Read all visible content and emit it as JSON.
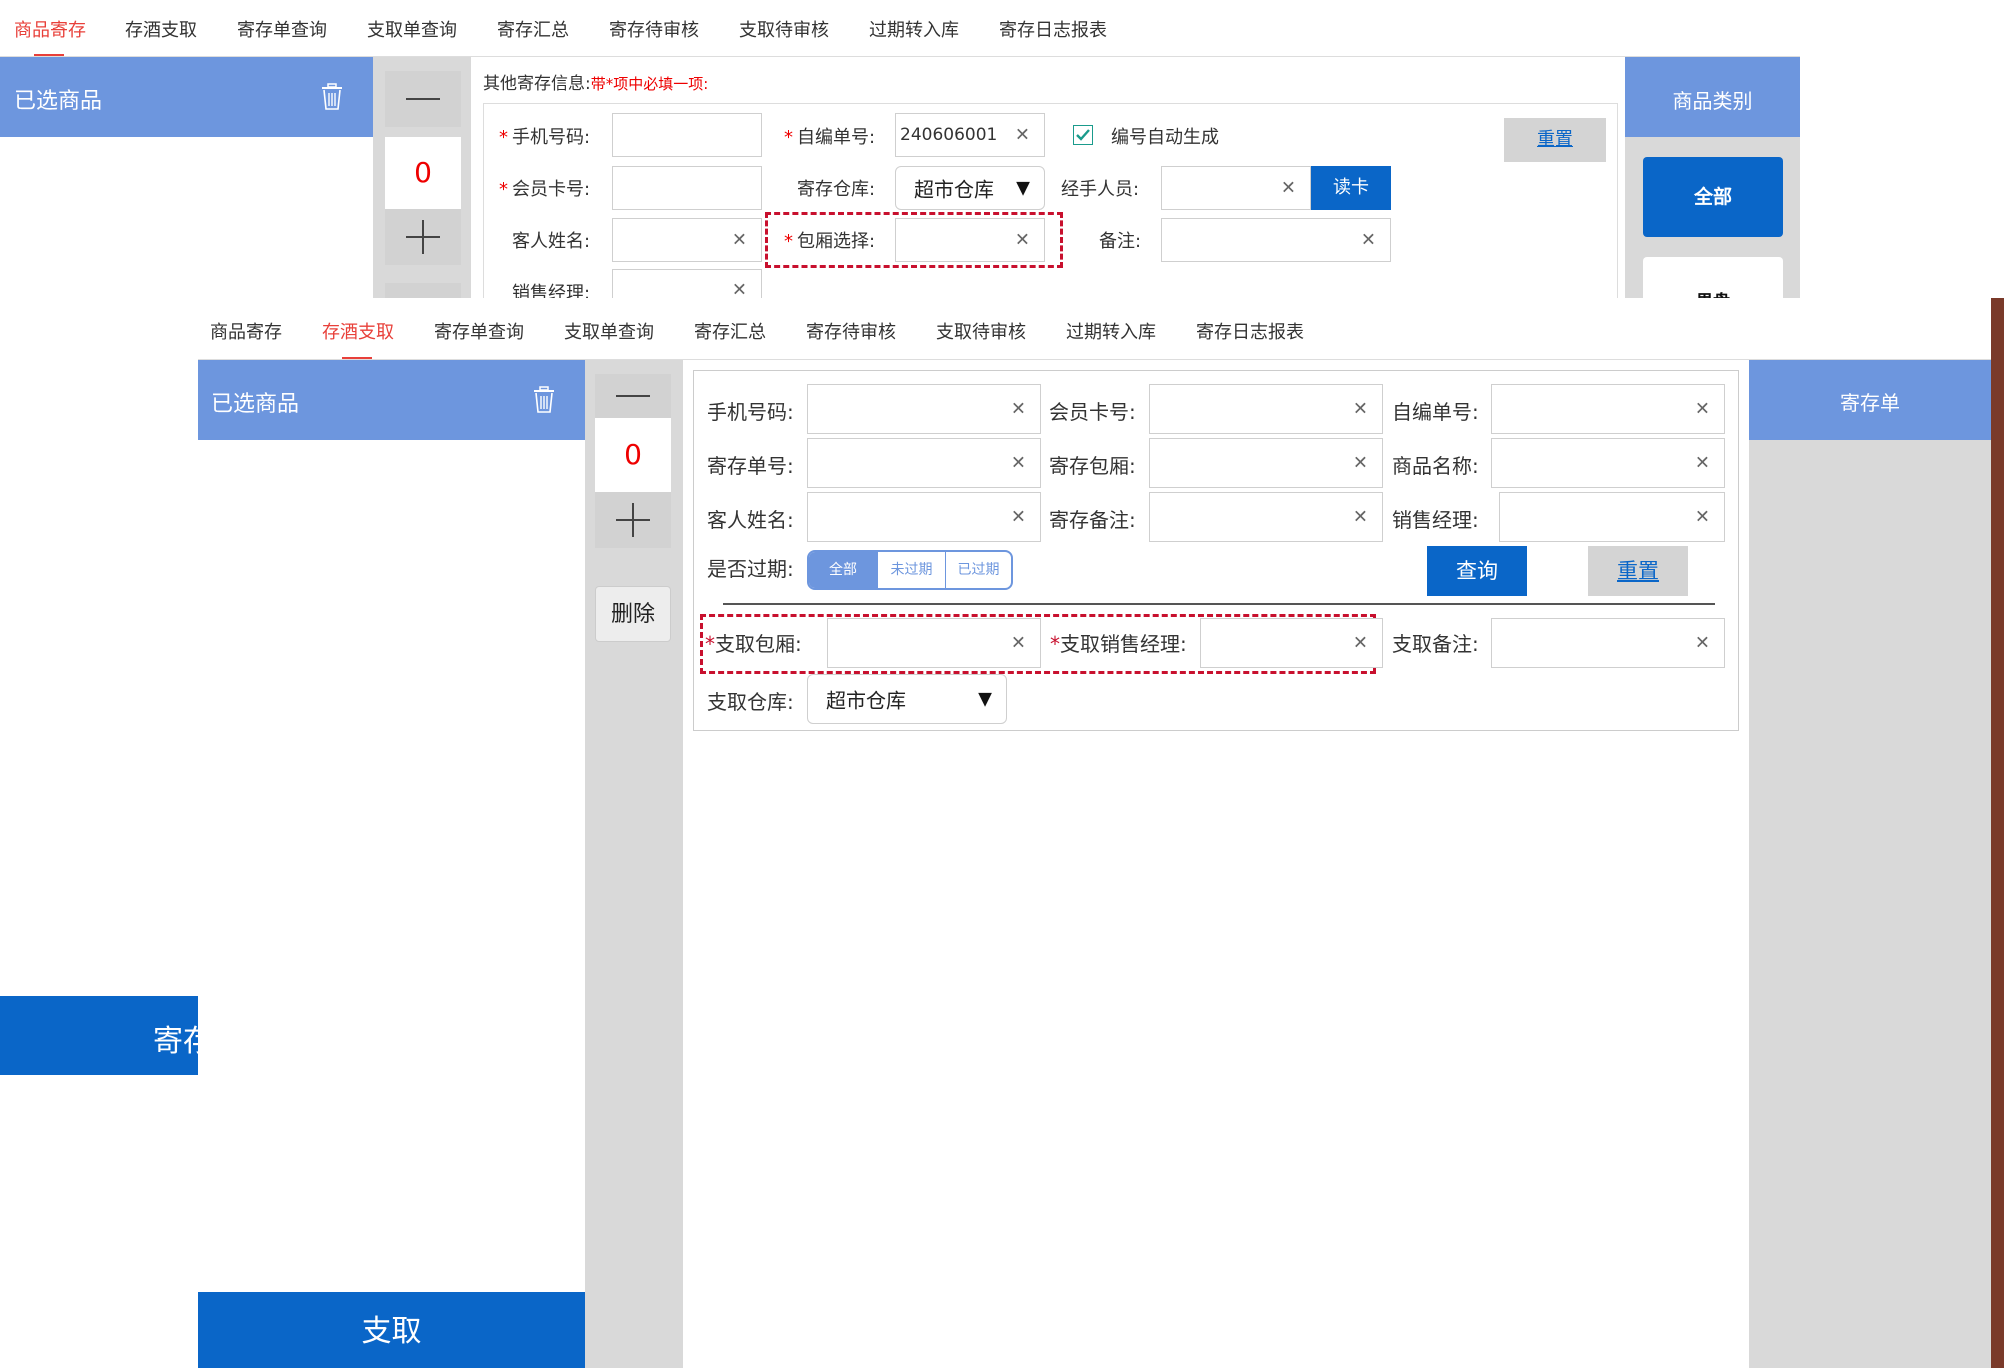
{
  "top": {
    "tabs": [
      "商品寄存",
      "存酒支取",
      "寄存单查询",
      "支取单查询",
      "寄存汇总",
      "寄存待审核",
      "支取待审核",
      "过期转入库",
      "寄存日志报表"
    ],
    "selected_header": "已选商品",
    "qty": "0",
    "form_title": "其他寄存信息:",
    "form_required_note": "带*项中必填一项:",
    "labels": {
      "phone": "手机号码:",
      "custom_no": "自编单号:",
      "member": "会员卡号:",
      "warehouse": "寄存仓库:",
      "handler": "经手人员:",
      "guest": "客人姓名:",
      "room": "包厢选择:",
      "note": "备注:",
      "manager": "销售经理:"
    },
    "custom_no_value": "240606001",
    "auto_gen_label": "编号自动生成",
    "warehouse_value": "超市仓库",
    "read_card": "读卡",
    "reset": "重置",
    "category_header": "商品类别",
    "category_all": "全部",
    "category_partial": "果盘"
  },
  "bottom": {
    "tabs": [
      "商品寄存",
      "存酒支取",
      "寄存单查询",
      "支取单查询",
      "寄存汇总",
      "寄存待审核",
      "支取待审核",
      "过期转入库",
      "寄存日志报表"
    ],
    "selected_header": "已选商品",
    "qty": "0",
    "delete": "删除",
    "labels": {
      "phone": "手机号码:",
      "member": "会员卡号:",
      "custom_no": "自编单号:",
      "deposit_no": "寄存单号:",
      "deposit_room": "寄存包厢:",
      "product": "商品名称:",
      "guest": "客人姓名:",
      "deposit_note": "寄存备注:",
      "manager": "销售经理:",
      "expired": "是否过期:",
      "withdraw_room": "支取包厢:",
      "withdraw_manager": "支取销售经理:",
      "withdraw_note": "支取备注:",
      "withdraw_warehouse": "支取仓库:"
    },
    "expiry_options": [
      "全部",
      "未过期",
      "已过期"
    ],
    "query": "查询",
    "reset": "重置",
    "warehouse_value": "超市仓库",
    "right_header": "寄存单",
    "withdraw_button": "支取",
    "left_partial_button": "寄存"
  },
  "colors": {
    "accent_red": "#e8403a",
    "panel_blue": "#6d96de",
    "button_blue": "#0a66c8",
    "required_red": "#c8102e"
  }
}
